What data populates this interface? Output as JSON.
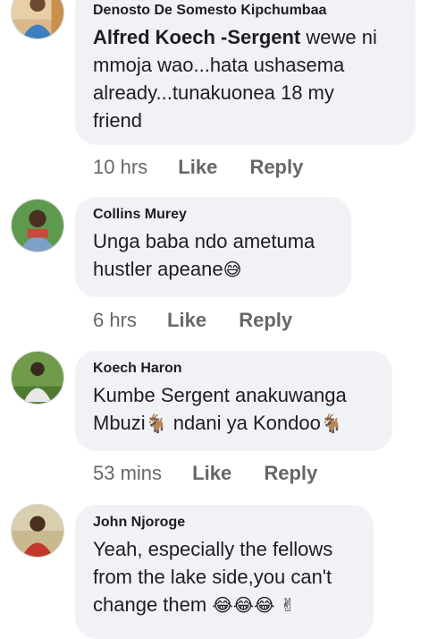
{
  "comments": [
    {
      "author": "Denosto De Somesto Kipchumbaa",
      "mention": "Alfred Koech -Sergent",
      "lines": [
        " wewe ni",
        "mmoja wao...hata ushasema",
        "already...tunakuonea 18 my",
        "friend"
      ],
      "time": "10 hrs",
      "like": "Like",
      "reply": "Reply"
    },
    {
      "author": "Collins Murey",
      "lines": [
        "Unga baba ndo ametuma",
        "hustler apeane"
      ],
      "emojis": [
        "😅"
      ],
      "time": "6 hrs",
      "like": "Like",
      "reply": "Reply"
    },
    {
      "author": "Koech Haron",
      "lines": [
        "Kumbe Sergent anakuwanga",
        "Mbuzi",
        " ndani ya Kondoo"
      ],
      "emojis": [
        "🐐",
        "🐐"
      ],
      "time": "53 mins",
      "like": "Like",
      "reply": "Reply"
    },
    {
      "author": "John Njoroge",
      "lines": [
        "Yeah, especially the fellows",
        "from the lake side,you can't",
        "change them "
      ],
      "emojis": [
        "😂",
        "😂",
        "😂",
        "✌"
      ]
    }
  ]
}
